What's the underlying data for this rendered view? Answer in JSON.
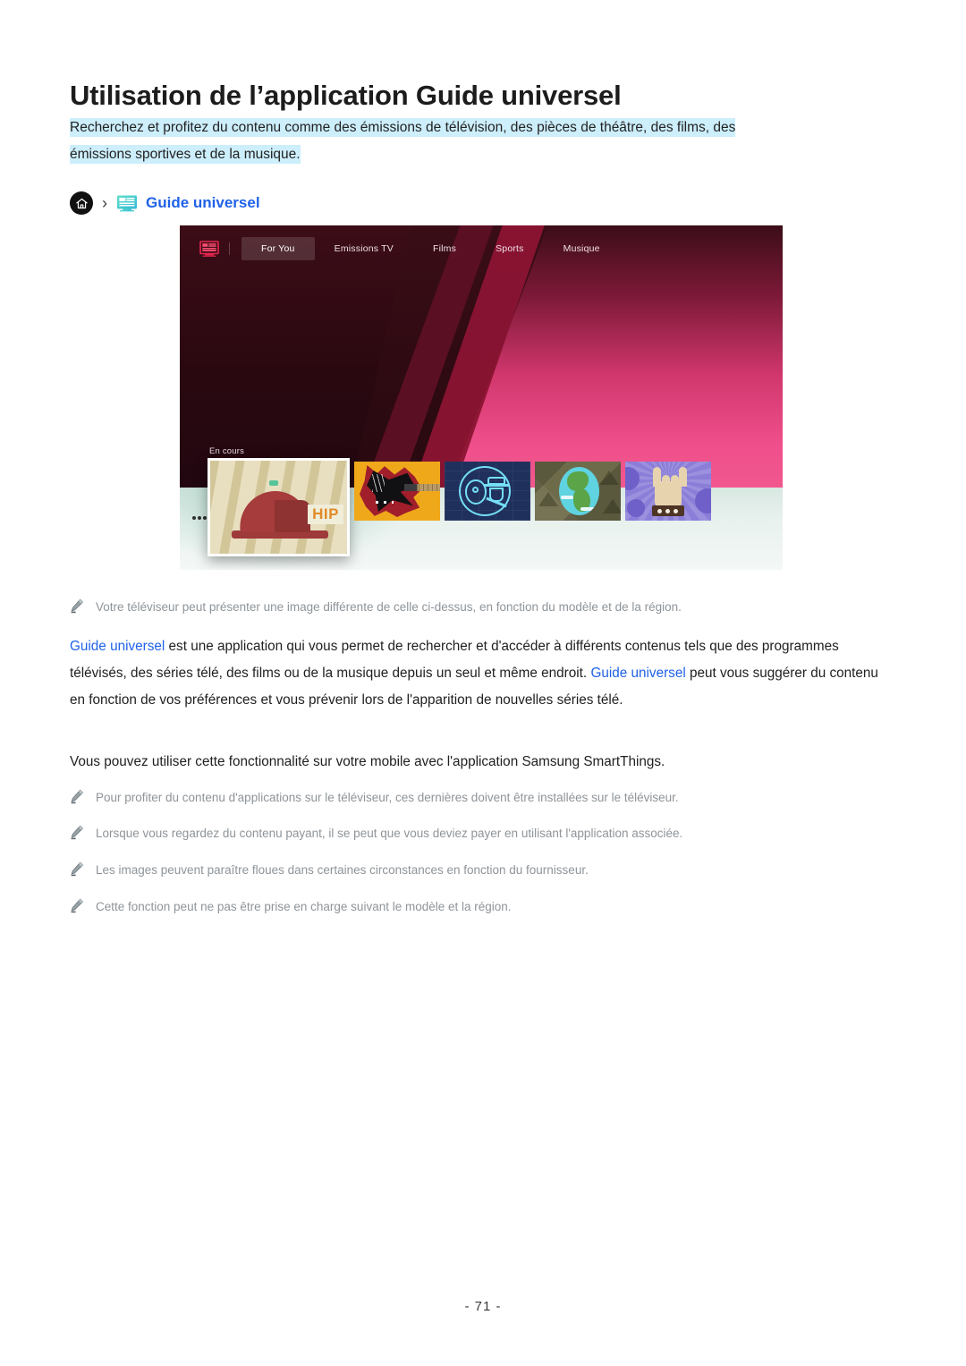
{
  "document": {
    "title": "Utilisation de l’application Guide universel",
    "intro_line1": "Recherchez et profitez du contenu comme des émissions de télévision, des pièces de théâtre, des films, des",
    "intro_line2": "émissions sportives et de la musique.",
    "page_number": "- 71 -",
    "highlight_color": "#cdeefb",
    "link_color": "#2062e8"
  },
  "breadcrumb": {
    "home_icon": "home-icon",
    "separator": "›",
    "path_icon": "universal-guide-monitor-icon",
    "label": "Guide universel"
  },
  "tv_screenshot": {
    "app_icon": "universal-guide-app-icon",
    "tabs": [
      {
        "label": "For You",
        "selected": true
      },
      {
        "label": "Emissions TV",
        "selected": false
      },
      {
        "label": "Films",
        "selected": false
      },
      {
        "label": "Sports",
        "selected": false
      },
      {
        "label": "Musique",
        "selected": false
      }
    ],
    "row_label": "En cours",
    "thumbnails": [
      {
        "name": "hip-hop-cap-thumbnail",
        "focused": true
      },
      {
        "name": "electric-guitar-thumbnail",
        "focused": false
      },
      {
        "name": "neon-ukulele-thumbnail",
        "focused": false
      },
      {
        "name": "globe-thumbnail",
        "focused": false
      },
      {
        "name": "rock-hand-thumbnail",
        "focused": false
      }
    ]
  },
  "notes": {
    "image_note": "Votre téléviseur peut présenter une image différente de celle ci-dessus, en fonction du modèle et de la région.",
    "apps_note": "Pour profiter du contenu d'applications sur le téléviseur, ces dernières doivent être installées sur le téléviseur.",
    "paid_note": "Lorsque vous regardez du contenu payant, il se peut que vous deviez payer en utilisant l'application associée.",
    "blurry_note": "Les images peuvent paraître floues dans certaines circonstances en fonction du fournisseur.",
    "support_note": "Cette fonction peut ne pas être prise en charge suivant le modèle et la région."
  },
  "body": {
    "p1_link1": "Guide universel",
    "p1_text1": " est une application qui vous permet de rechercher et d'accéder à différents contenus tels que des programmes télévisés, des séries télé, des films ou de la musique depuis un seul et même endroit. ",
    "p1_link2": "Guide universel",
    "p1_text2": " peut vous suggérer du contenu en fonction de vos préférences et vous prévenir lors de l'apparition de nouvelles séries télé.",
    "p2": "Vous pouvez utiliser cette fonctionnalité sur votre mobile avec l'application Samsung SmartThings."
  }
}
